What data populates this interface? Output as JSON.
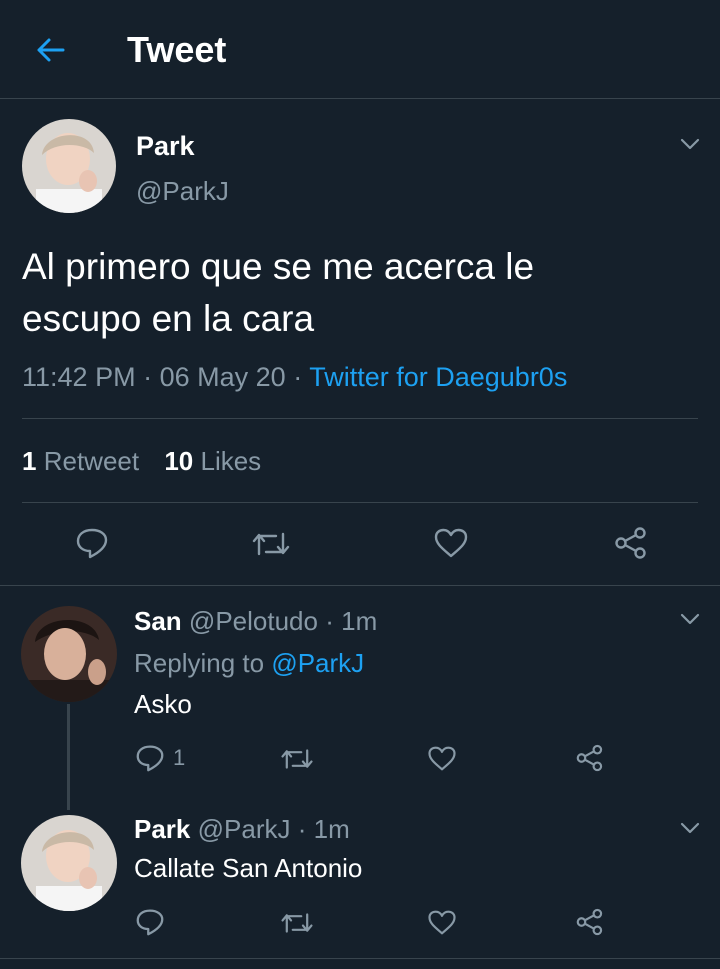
{
  "header": {
    "title": "Tweet"
  },
  "main_tweet": {
    "name": "Park",
    "handle": "@ParkJ",
    "text_line1": "Al primero que se me acerca le",
    "text_line2": "escupo en la cara",
    "time": "11:42 PM",
    "sep1": "·",
    "date": "06 May 20",
    "sep2": "·",
    "source": "Twitter for Daegubr0s",
    "retweets_count": "1",
    "retweets_label": "Retweet",
    "likes_count": "10",
    "likes_label": "Likes"
  },
  "replies": [
    {
      "name": "San",
      "handle": "@Pelotudo",
      "dot": "·",
      "time": "1m",
      "replying_label": "Replying to",
      "replying_to": "@ParkJ",
      "text": "Asko",
      "reply_count": "1"
    },
    {
      "name": "Park",
      "handle": "@ParkJ",
      "dot": "·",
      "time": "1m",
      "text": "Callate San Antonio"
    }
  ],
  "colors": {
    "background": "#15202b",
    "accent": "#1da1f2",
    "muted": "#8899a6",
    "divider": "#38444d"
  }
}
